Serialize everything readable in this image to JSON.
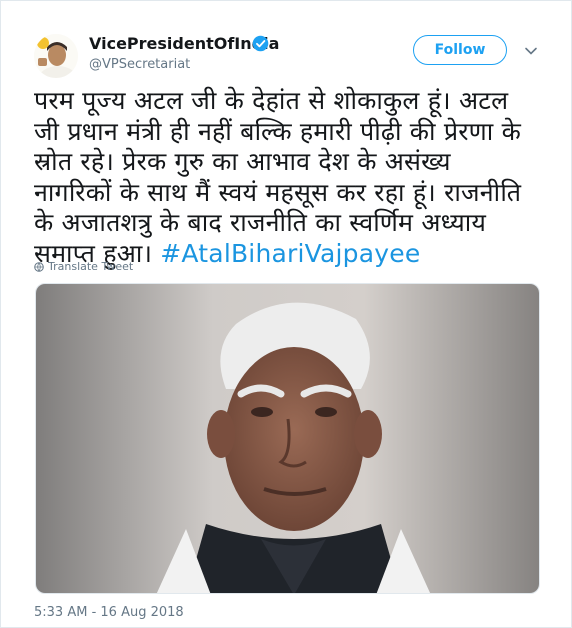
{
  "tweet": {
    "display_name": "VicePresidentOfIndia",
    "handle": "@VPSecretariat",
    "follow_label": "Follow",
    "text_lines": [
      "परम पूज्य अटल जी के देहांत से शोकाकुल हूं। अटल",
      "जी प्रधान मंत्री ही नहीं बल्कि हमारी पीढ़ी की प्रेरणा के",
      "स्रोत रहे। प्रेरक गुरु का आभाव देश के असंख्य",
      "नागरिकों के साथ मैं स्वयं महसूस कर रहा हूं। राजनीति",
      "के अजातशत्रु के बाद राजनीति का स्वर्णिम अध्याय",
      "समाप्त हुआ।"
    ],
    "hashtag": "#AtalBihariVajpayee",
    "translate_label": "Translate Tweet",
    "timestamp": "5:33 AM - 16 Aug 2018",
    "colors": {
      "link": "#1b95e0",
      "accent": "#1da1f2",
      "muted": "#657786"
    }
  }
}
